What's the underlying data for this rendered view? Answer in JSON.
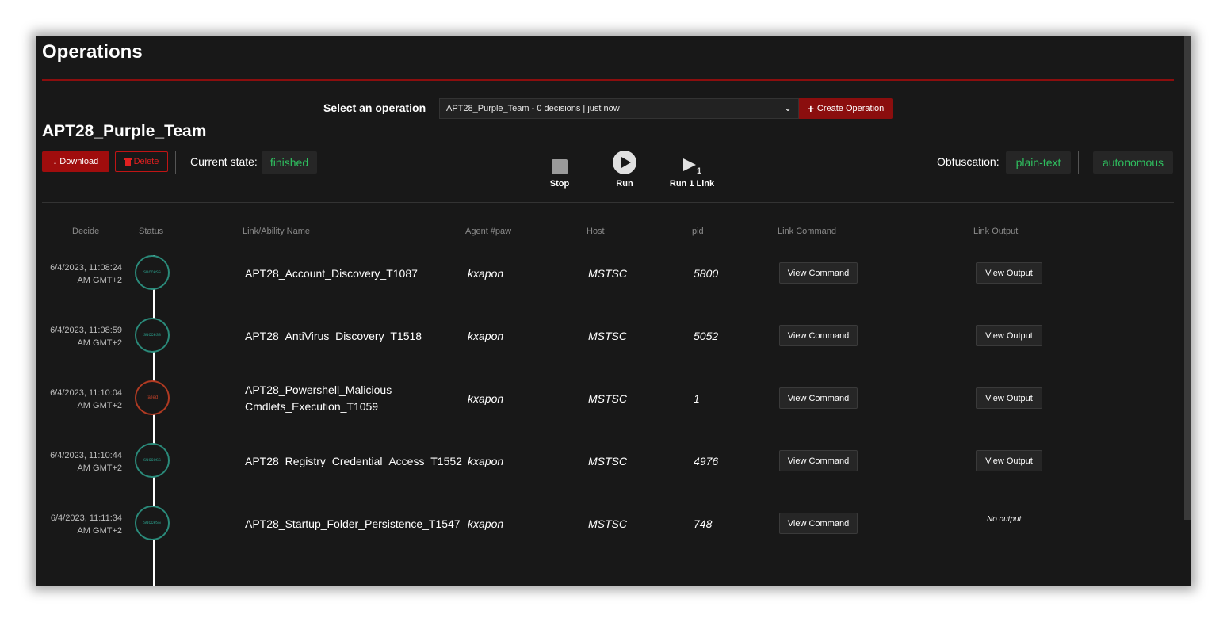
{
  "page": {
    "title": "Operations"
  },
  "selector": {
    "label": "Select an operation",
    "selected": "APT28_Purple_Team - 0 decisions | just now",
    "create_label": "Create Operation"
  },
  "operation": {
    "name": "APT28_Purple_Team",
    "download_label": "Download",
    "delete_label": "Delete",
    "state_label": "Current state:",
    "state_value": "finished",
    "obfuscation_label": "Obfuscation:",
    "obfuscation_value": "plain-text",
    "autonomy_value": "autonomous"
  },
  "controls": {
    "stop": "Stop",
    "run": "Run",
    "run_one": "Run 1 Link"
  },
  "table": {
    "headers": {
      "decide": "Decide",
      "status": "Status",
      "ability": "Link/Ability Name",
      "agent": "Agent #paw",
      "host": "Host",
      "pid": "pid",
      "command": "Link Command",
      "output": "Link Output"
    },
    "rows": [
      {
        "date1": "6/4/2023, 11:08:24",
        "date2": "AM GMT+2",
        "status": "success",
        "ability": "APT28_Account_Discovery_T1087",
        "agent": "kxapon",
        "host": "MSTSC",
        "pid": "5800",
        "command_label": "View Command",
        "output_label": "View Output"
      },
      {
        "date1": "6/4/2023, 11:08:59",
        "date2": "AM GMT+2",
        "status": "success",
        "ability": "APT28_AntiVirus_Discovery_T1518",
        "agent": "kxapon",
        "host": "MSTSC",
        "pid": "5052",
        "command_label": "View Command",
        "output_label": "View Output"
      },
      {
        "date1": "6/4/2023, 11:10:04",
        "date2": "AM GMT+2",
        "status": "failed",
        "ability": "APT28_Powershell_Malicious Cmdlets_Execution_T1059",
        "agent": "kxapon",
        "host": "MSTSC",
        "pid": "1",
        "command_label": "View Command",
        "output_label": "View Output"
      },
      {
        "date1": "6/4/2023, 11:10:44",
        "date2": "AM GMT+2",
        "status": "success",
        "ability": "APT28_Registry_Credential_Access_T1552",
        "agent": "kxapon",
        "host": "MSTSC",
        "pid": "4976",
        "command_label": "View Command",
        "output_label": "View Output"
      },
      {
        "date1": "6/4/2023, 11:11:34",
        "date2": "AM GMT+2",
        "status": "success",
        "ability": "APT28_Startup_Folder_Persistence_T1547",
        "agent": "kxapon",
        "host": "MSTSC",
        "pid": "748",
        "command_label": "View Command",
        "no_output": "No output."
      }
    ]
  },
  "colors": {
    "background": "#181818",
    "accent_red": "#8b0e0e",
    "success": "#2a8a7a",
    "failed": "#b03a22",
    "tag_text": "#2fbf5f"
  }
}
